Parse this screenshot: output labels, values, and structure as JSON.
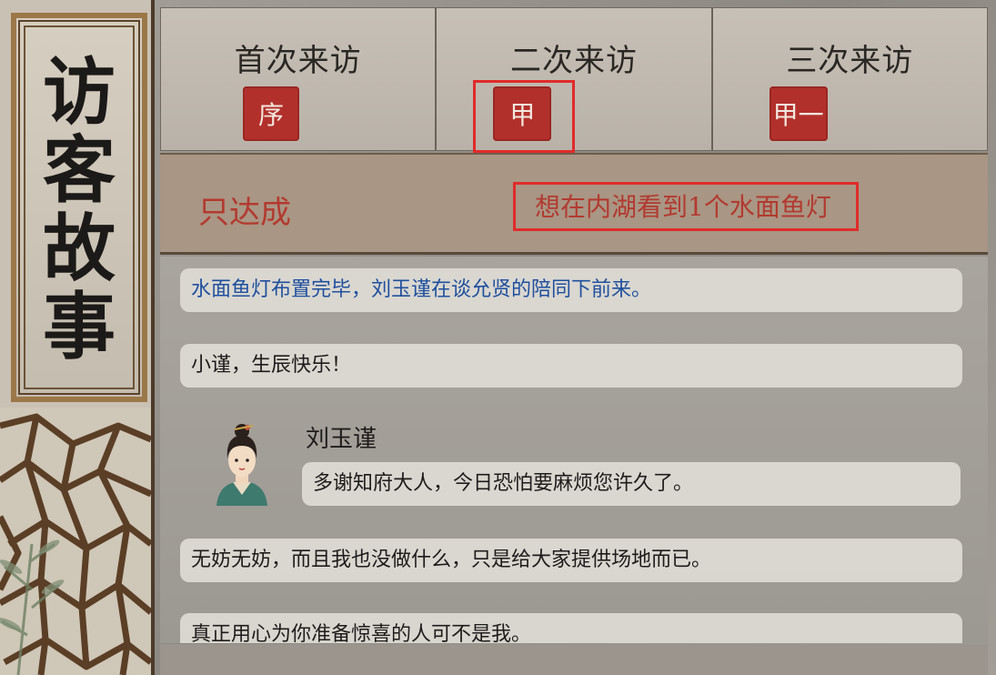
{
  "sidebar": {
    "title_chars": [
      "访",
      "客",
      "故",
      "事"
    ]
  },
  "tabs": [
    {
      "label": "首次来访",
      "seal": "序"
    },
    {
      "label": "二次来访",
      "seal": "甲",
      "selected": true
    },
    {
      "label": "三次来访",
      "seal": "甲一"
    }
  ],
  "condition": {
    "label": "只达成",
    "requirement": "想在内湖看到1个水面鱼灯"
  },
  "story": {
    "system_line": "水面鱼灯布置完毕，刘玉谨在谈允贤的陪同下前来。",
    "player_line_1": "小谨，生辰快乐！",
    "speaker_name": "刘玉谨",
    "speaker_line": "多谢知府大人，今日恐怕要麻烦您许久了。",
    "player_line_2": "无妨无妨，而且我也没做什么，只是给大家提供场地而已。",
    "player_line_3": "真正用心为你准备惊喜的人可不是我。"
  },
  "colors": {
    "seal_red": "#b2302b",
    "highlight_red": "#e02b2b",
    "system_text_blue": "#1e4f9e",
    "condition_text": "#b23a30"
  }
}
